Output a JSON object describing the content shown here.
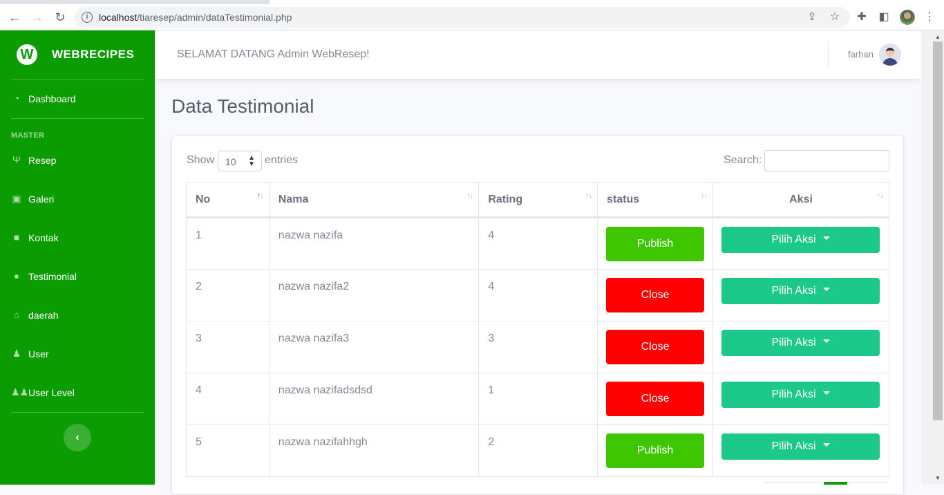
{
  "browser": {
    "url_host": "localhost",
    "url_path": "/tiaresep/admin/dataTestimonial.php"
  },
  "sidebar": {
    "brand_letter": "W",
    "brand_name": "WEBRECIPES",
    "heading": "MASTER",
    "items": [
      {
        "label": "Dashboard",
        "icon": "tachometer-icon"
      },
      {
        "label": "Resep",
        "icon": "utensils-icon"
      },
      {
        "label": "Galeri",
        "icon": "image-icon"
      },
      {
        "label": "Kontak",
        "icon": "message-icon"
      },
      {
        "label": "Testimonial",
        "icon": "comment-icon"
      },
      {
        "label": "daerah",
        "icon": "home-icon"
      },
      {
        "label": "User",
        "icon": "user-icon"
      },
      {
        "label": "User Level",
        "icon": "users-icon"
      }
    ]
  },
  "topbar": {
    "welcome": "SELAMAT DATANG Admin WebResep!",
    "username": "farhan"
  },
  "page": {
    "title": "Data Testimonial"
  },
  "table_controls": {
    "show_label": "Show",
    "entries_value": "10",
    "entries_label": "entries",
    "search_label": "Search:",
    "search_value": ""
  },
  "table": {
    "columns": [
      "No",
      "Nama",
      "Rating",
      "status",
      "Aksi"
    ],
    "rows": [
      {
        "no": "1",
        "nama": "nazwa nazifa",
        "rating": "4",
        "status": "Publish",
        "aksi": "Pilih Aksi"
      },
      {
        "no": "2",
        "nama": "nazwa nazifa2",
        "rating": "4",
        "status": "Close",
        "aksi": "Pilih Aksi"
      },
      {
        "no": "3",
        "nama": "nazwa nazifa3",
        "rating": "3",
        "status": "Close",
        "aksi": "Pilih Aksi"
      },
      {
        "no": "4",
        "nama": "nazwa nazifadsdsd",
        "rating": "1",
        "status": "Close",
        "aksi": "Pilih Aksi"
      },
      {
        "no": "5",
        "nama": "nazwa nazifahhgh",
        "rating": "2",
        "status": "Publish",
        "aksi": "Pilih Aksi"
      }
    ]
  },
  "colors": {
    "sidebar": "#0a9c00",
    "publish": "#3ec600",
    "close": "#ff0000",
    "aksi": "#1cc88a"
  }
}
